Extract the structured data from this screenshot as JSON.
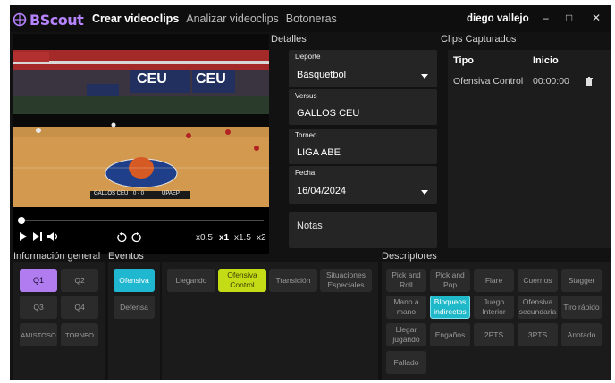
{
  "app": {
    "brand": "BScout",
    "menu": [
      "Crear videoclips",
      "Analizar videoclips",
      "Botoneras"
    ],
    "user": "diego vallejo",
    "window_controls": {
      "minimize": "–",
      "maximize": "□",
      "close": "✕"
    }
  },
  "video": {
    "scoreboard": {
      "home": "GALLOS CEU",
      "score": "0 - 0",
      "away": "UPAEP"
    },
    "banners": [
      "CEU",
      "CEU"
    ],
    "progress": 0.01,
    "speeds": [
      "x0.5",
      "x1",
      "x1.5",
      "x2"
    ]
  },
  "details": {
    "title": "Detalles",
    "fields": {
      "deporte": {
        "label": "Deporte",
        "value": "Básquetbol"
      },
      "versus": {
        "label": "Versus",
        "value": "GALLOS CEU"
      },
      "torneo": {
        "label": "Torneo",
        "value": "LIGA ABE"
      },
      "fecha": {
        "label": "Fecha",
        "value": "16/04/2024"
      }
    },
    "notes_placeholder": "Notas"
  },
  "clips": {
    "title": "Clips Capturados",
    "columns": [
      "Tipo",
      "Inicio"
    ],
    "rows": [
      {
        "tipo": "Ofensiva Control",
        "inicio": "00:00:00"
      }
    ]
  },
  "info_general": {
    "title": "Información general",
    "buttons": [
      "Q1",
      "Q2",
      "Q3",
      "Q4",
      "AMISTOSO",
      "TORNEO"
    ]
  },
  "eventos": {
    "title": "Eventos",
    "buttons": [
      "Ofensiva",
      "Defensa",
      "Llegando",
      "Ofensiva Control",
      "Transición",
      "Situaciones Especiales"
    ]
  },
  "descriptores": {
    "title": "Descriptores",
    "buttons": [
      "Pick and Roll",
      "Pick and Pop",
      "Flare",
      "Cuernos",
      "Stagger",
      "Mano a mano",
      "Bloqueos indirectos",
      "Juego Interior",
      "Ofensiva secundaria",
      "Tiro rápido",
      "Llegar jugando",
      "Engaños",
      "2PTS",
      "3PTS",
      "Anotado",
      "Fallado"
    ]
  },
  "colors": {
    "accent_purple": "#b07cf0",
    "accent_cyan": "#20b8d0",
    "accent_lime": "#c4dc16",
    "background": "#121212"
  }
}
